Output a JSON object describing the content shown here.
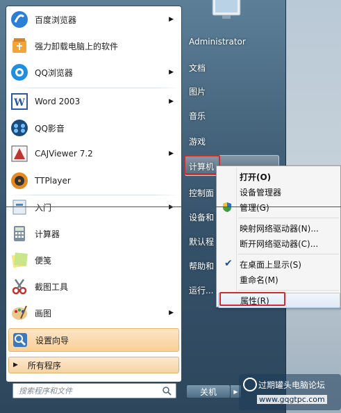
{
  "start_menu": {
    "programs": [
      {
        "label": "百度浏览器",
        "icon": "baidu-browser-icon",
        "has_arrow": true
      },
      {
        "label": "强力卸载电脑上的软件",
        "icon": "uninstaller-icon",
        "has_arrow": false
      },
      {
        "label": "QQ浏览器",
        "icon": "qq-browser-icon",
        "has_arrow": true
      },
      {
        "label": "Word 2003",
        "icon": "word-icon",
        "has_arrow": true
      },
      {
        "label": "QQ影音",
        "icon": "qq-player-icon",
        "has_arrow": false
      },
      {
        "label": "CAJViewer 7.2",
        "icon": "cajviewer-icon",
        "has_arrow": true
      },
      {
        "label": "TTPlayer",
        "icon": "ttplayer-icon",
        "has_arrow": false
      },
      {
        "label": "入门",
        "icon": "getting-started-icon",
        "has_arrow": true
      },
      {
        "label": "计算器",
        "icon": "calculator-icon",
        "has_arrow": false
      },
      {
        "label": "便笺",
        "icon": "sticky-notes-icon",
        "has_arrow": false
      },
      {
        "label": "截图工具",
        "icon": "snipping-tool-icon",
        "has_arrow": false
      },
      {
        "label": "画图",
        "icon": "paint-icon",
        "has_arrow": true
      },
      {
        "label": "设置向导",
        "icon": "setup-wizard-icon",
        "has_arrow": false
      }
    ],
    "all_programs": "所有程序",
    "search_placeholder": "搜索程序和文件"
  },
  "right_column": {
    "user": "Administrator",
    "documents": "文档",
    "pictures": "图片",
    "music": "音乐",
    "games": "游戏",
    "computer": "计算机",
    "control_panel": "控制面",
    "devices": "设备和",
    "default": "默认程",
    "help": "帮助和",
    "run": "运行...",
    "shutdown": "关机"
  },
  "context_menu": {
    "open": "打开(O)",
    "device_manager": "设备管理器",
    "manage": "管理(G)",
    "map_drive": "映射网络驱动器(N)...",
    "disconnect_drive": "断开网络驱动器(C)...",
    "show_on_desktop": "在桌面上显示(S)",
    "rename": "重命名(M)",
    "properties": "属性(R)"
  },
  "watermark": {
    "title": "过期罐头电脑论坛",
    "url": "www.gqgtpc.com"
  },
  "colors": {
    "highlight_orange": "#f9cf95",
    "annotation_red": "#d22a2a",
    "frame_blue": "#35526a"
  }
}
